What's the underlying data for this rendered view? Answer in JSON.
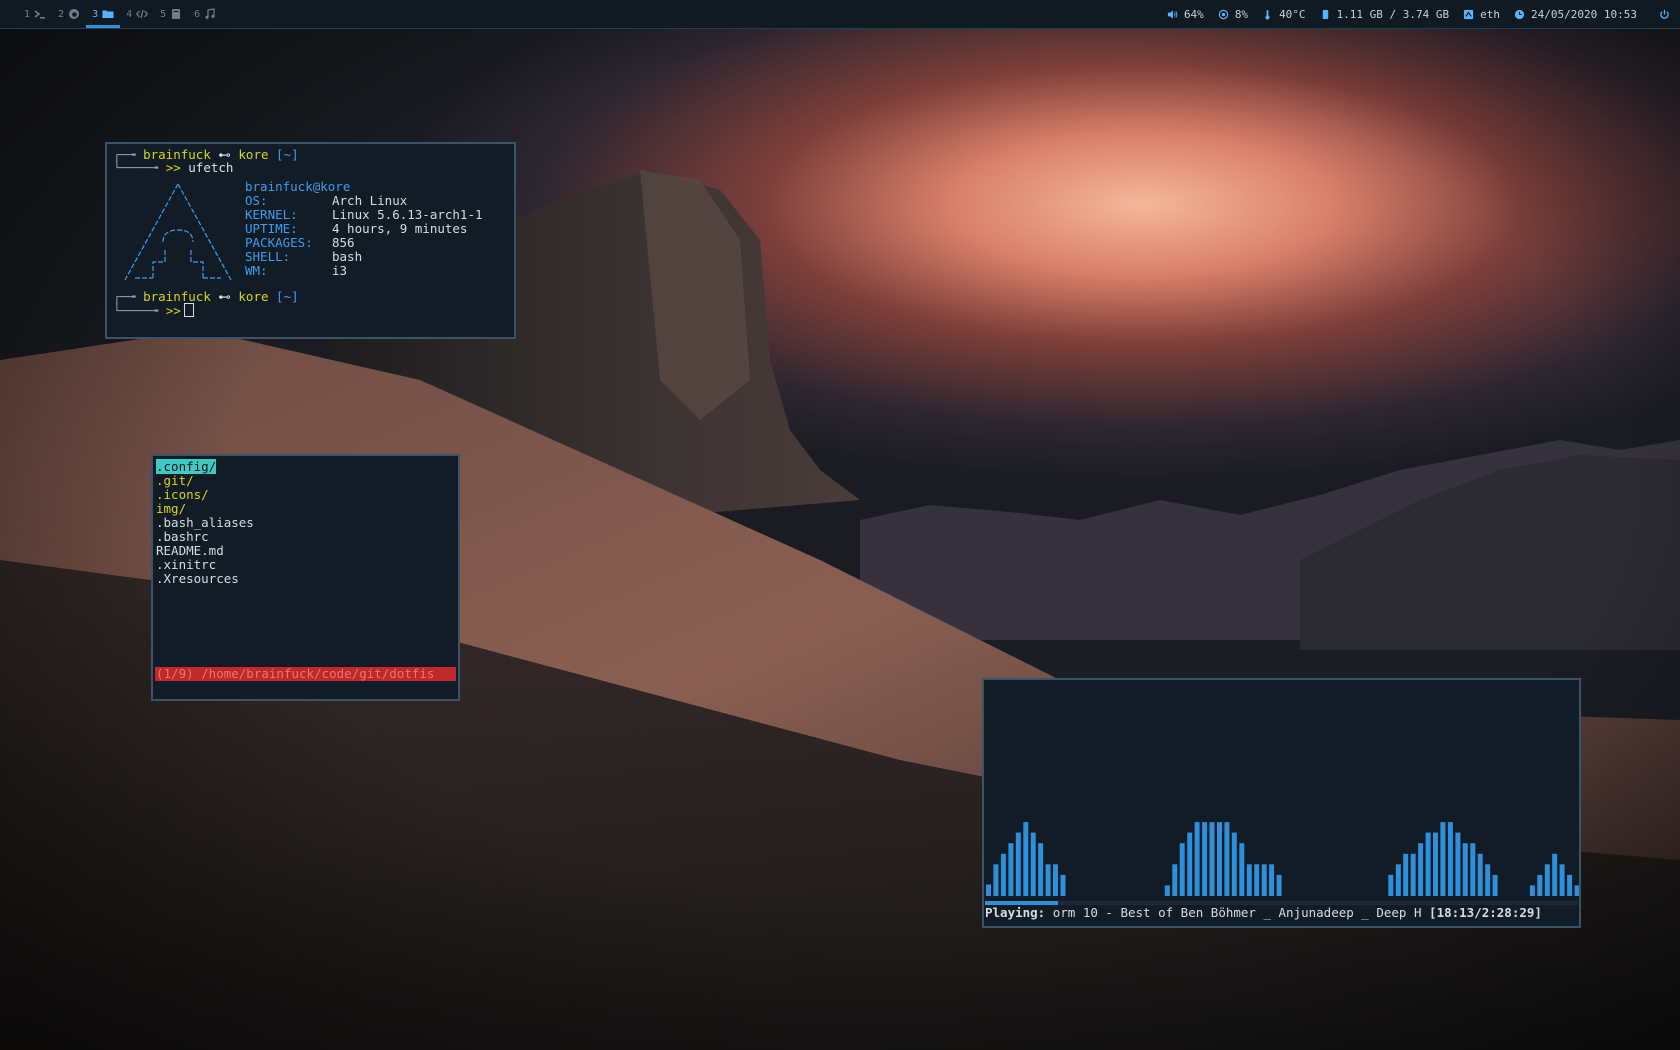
{
  "colors": {
    "accent": "#2f8fd9",
    "bar_bg": "#0f1a23",
    "window_bg": "#121c26",
    "yellow": "#d9d421",
    "blue": "#3d9cf0",
    "cyan_highlight": "#3ccac2",
    "status_red": "#c0282b"
  },
  "topbar": {
    "workspaces": [
      {
        "num": "1",
        "icon": "terminal-icon"
      },
      {
        "num": "2",
        "icon": "firefox-icon"
      },
      {
        "num": "3",
        "icon": "folder-icon",
        "active": true
      },
      {
        "num": "4",
        "icon": "code-icon"
      },
      {
        "num": "5",
        "icon": "book-icon"
      },
      {
        "num": "6",
        "icon": "music-icon"
      }
    ],
    "status": {
      "volume": "64%",
      "cpu": "8%",
      "temp": "40°C",
      "memory": "1.11 GB / 3.74 GB",
      "network": "eth",
      "datetime": "24/05/2020 10:53"
    }
  },
  "terminal": {
    "prompt_user": "brainfuck",
    "prompt_arrow": "⊷",
    "prompt_host": "kore",
    "prompt_dir": "[~]",
    "prompt_symbol": ">>",
    "command": "ufetch",
    "userhost": "brainfuck@kore",
    "info": [
      {
        "key": "OS:",
        "value": "Arch Linux"
      },
      {
        "key": "KERNEL:",
        "value": "Linux 5.6.13-arch1-1"
      },
      {
        "key": "UPTIME:",
        "value": "4 hours, 9 minutes"
      },
      {
        "key": "PACKAGES:",
        "value": "856"
      },
      {
        "key": "SHELL:",
        "value": "bash"
      },
      {
        "key": "WM:",
        "value": "i3"
      }
    ]
  },
  "file_manager": {
    "items": [
      {
        "name": ".config/",
        "type": "dir",
        "selected": true
      },
      {
        "name": ".git/",
        "type": "dir"
      },
      {
        "name": ".icons/",
        "type": "dir"
      },
      {
        "name": "img/",
        "type": "dir"
      },
      {
        "name": ".bash_aliases",
        "type": "file"
      },
      {
        "name": ".bashrc",
        "type": "file"
      },
      {
        "name": "README.md",
        "type": "file"
      },
      {
        "name": ".xinitrc",
        "type": "file"
      },
      {
        "name": ".Xresources",
        "type": "file"
      }
    ],
    "status": "(1/9) /home/brainfuck/code/git/dotfis"
  },
  "visualizer": {
    "bar_levels": [
      0.12,
      0.33,
      0.44,
      0.55,
      0.66,
      0.77,
      0.66,
      0.55,
      0.33,
      0.33,
      0.22,
      0,
      0,
      0,
      0,
      0,
      0,
      0,
      0,
      0,
      0,
      0,
      0,
      0,
      0.11,
      0.33,
      0.55,
      0.66,
      0.77,
      0.77,
      0.77,
      0.77,
      0.77,
      0.66,
      0.55,
      0.33,
      0.33,
      0.33,
      0.33,
      0.22,
      0,
      0,
      0,
      0,
      0,
      0,
      0,
      0,
      0,
      0,
      0,
      0,
      0,
      0,
      0.22,
      0.33,
      0.44,
      0.44,
      0.55,
      0.66,
      0.66,
      0.77,
      0.77,
      0.66,
      0.55,
      0.55,
      0.44,
      0.33,
      0.22,
      0,
      0,
      0,
      0,
      0.11,
      0.22,
      0.33,
      0.44,
      0.33,
      0.22,
      0.11
    ],
    "playing_label": "Playing:",
    "track": "orm 10 - Best of Ben Böhmer _ Anjunadeep _ Deep H",
    "time": "[18:13/2:28:29]",
    "progress": 0.123
  }
}
